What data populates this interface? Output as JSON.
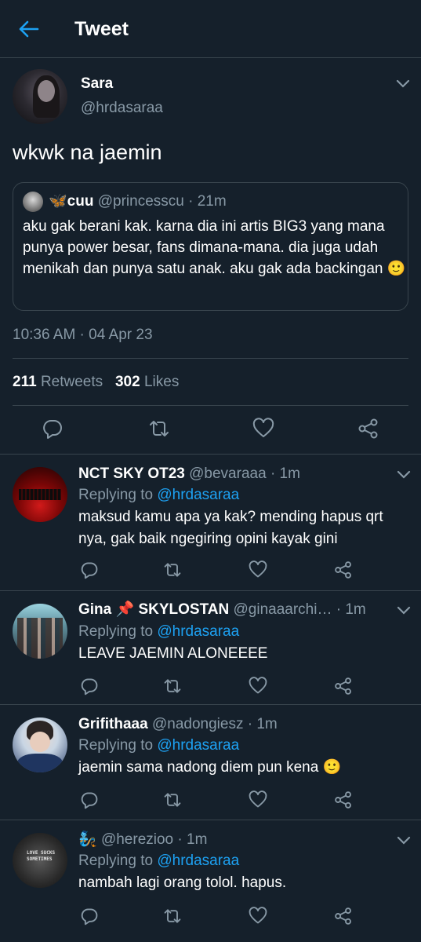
{
  "header": {
    "title": "Tweet"
  },
  "tweet": {
    "author_name": "Sara",
    "author_handle": "@hrdasaraa",
    "text": "wkwk na jaemin",
    "quote": {
      "emoji": "🦋",
      "name": "cuu",
      "handle": "@princesscu",
      "time": "· 21m",
      "text": "aku gak berani kak. karna dia ini artis BIG3 yang mana punya power besar, fans dimana-mana. dia juga udah menikah dan punya satu anak. aku gak ada backingan 🙂"
    },
    "timestamp": "10:36 AM · 04 Apr 23",
    "retweets": "211",
    "retweets_label": "Retweets",
    "likes": "302",
    "likes_label": "Likes"
  },
  "replies": [
    {
      "name": "NCT SKY OT23",
      "handle": "@bevaraaa",
      "time": "· 1m",
      "replying_prefix": "Replying to",
      "replying_to": "@hrdasaraa",
      "text": "maksud kamu apa ya kak? mending hapus qrt nya, gak baik ngegiring opini kayak gini"
    },
    {
      "name": "Gina 📌 SKYLOSTAN",
      "handle": "@ginaaarchi…",
      "time": "· 1m",
      "replying_prefix": "Replying to",
      "replying_to": "@hrdasaraa",
      "text": "LEAVE JAEMIN ALONEEEE"
    },
    {
      "name": "Grifithaaa",
      "handle": "@nadongiesz",
      "time": "· 1m",
      "replying_prefix": "Replying to",
      "replying_to": "@hrdasaraa",
      "text": "jaemin sama nadong diem pun kena 🙂"
    },
    {
      "name": "🧞",
      "handle": "@herezioo",
      "time": "· 1m",
      "replying_prefix": "Replying to",
      "replying_to": "@hrdasaraa",
      "text": "nambah lagi orang tolol. hapus.",
      "avatar_text": "LOVE SUCKS SOMETIMES"
    }
  ],
  "colors": {
    "background": "#15202b",
    "accent": "#1da1f2",
    "muted": "#8899a6",
    "border": "#38444d"
  },
  "icons": [
    "back-arrow-icon",
    "chevron-down-icon",
    "reply-icon",
    "retweet-icon",
    "like-icon",
    "share-icon"
  ]
}
